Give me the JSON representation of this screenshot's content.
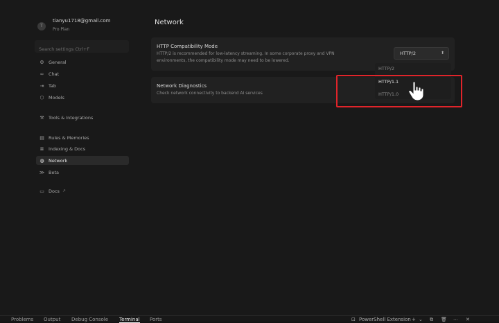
{
  "sidebar": {
    "avatar_letter": "T",
    "email": "tianyu1718@gmail.com",
    "plan": "Pro Plan",
    "search_placeholder": "Search settings Ctrl+F",
    "items": [
      {
        "label": "General",
        "icon": "gear-icon"
      },
      {
        "label": "Chat",
        "icon": "chat-icon"
      },
      {
        "label": "Tab",
        "icon": "tab-icon"
      },
      {
        "label": "Models",
        "icon": "models-icon"
      },
      {
        "label": "Tools & Integrations",
        "icon": "tools-icon"
      },
      {
        "label": "Rules & Memories",
        "icon": "rules-icon"
      },
      {
        "label": "Indexing & Docs",
        "icon": "database-icon"
      },
      {
        "label": "Network",
        "icon": "globe-icon",
        "active": true
      },
      {
        "label": "Beta",
        "icon": "beta-icon"
      },
      {
        "label": "Docs",
        "icon": "book-icon",
        "external": "↗"
      }
    ]
  },
  "main": {
    "title": "Network",
    "http_card": {
      "title": "HTTP Compatibility Mode",
      "desc_line1": "HTTP/2 is recommended for low-latency streaming. In some corporate proxy and VPN",
      "desc_line2": "environments, the compatibility mode may need to be lowered.",
      "selected": "HTTP/2",
      "options": [
        "HTTP/2",
        "HTTP/1.1",
        "HTTP/1.0"
      ],
      "hovered_option": "HTTP/1.1"
    },
    "diag_card": {
      "title": "Network Diagnostics",
      "desc": "Check network connectivity to backend AI services"
    }
  },
  "panel": {
    "tabs": [
      "Problems",
      "Output",
      "Debug Console",
      "Terminal",
      "Ports"
    ],
    "active_tab": "Terminal",
    "terminal_label": "PowerShell Extension",
    "actions": [
      "+",
      "⌄",
      "⧉",
      "🗑",
      "⋯",
      "✕"
    ]
  },
  "colors": {
    "highlight": "#e0242a",
    "active_item": "#2a2a2a"
  }
}
